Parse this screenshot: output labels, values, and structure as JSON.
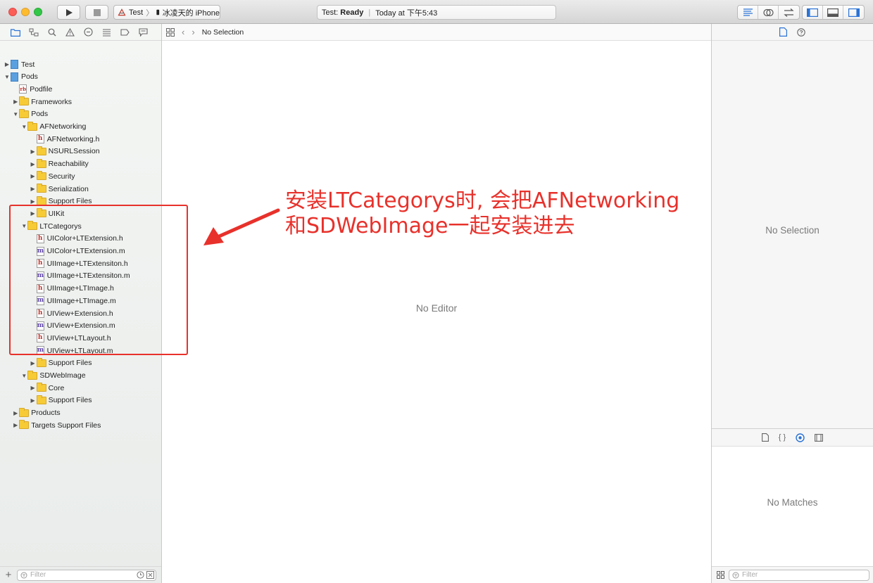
{
  "toolbar": {
    "scheme_name": "Test",
    "device_name": "冰凌天的 iPhone",
    "activity_prefix": "Test:",
    "activity_status": "Ready",
    "activity_time": "Today at 下午5:43"
  },
  "jump_bar": {
    "label": "No Selection"
  },
  "tree": [
    {
      "label": "Test",
      "kind": "project",
      "level": 0,
      "arrow": "▶"
    },
    {
      "label": "Pods",
      "kind": "project",
      "level": 0,
      "arrow": "▼"
    },
    {
      "label": "Podfile",
      "kind": "podfile",
      "level": 1,
      "arrow": ""
    },
    {
      "label": "Frameworks",
      "kind": "folder",
      "level": 1,
      "arrow": "▶"
    },
    {
      "label": "Pods",
      "kind": "folder",
      "level": 1,
      "arrow": "▼"
    },
    {
      "label": "AFNetworking",
      "kind": "folder",
      "level": 2,
      "arrow": "▼"
    },
    {
      "label": "AFNetworking.h",
      "kind": "h",
      "level": 3,
      "arrow": ""
    },
    {
      "label": "NSURLSession",
      "kind": "folder",
      "level": 3,
      "arrow": "▶"
    },
    {
      "label": "Reachability",
      "kind": "folder",
      "level": 3,
      "arrow": "▶"
    },
    {
      "label": "Security",
      "kind": "folder",
      "level": 3,
      "arrow": "▶"
    },
    {
      "label": "Serialization",
      "kind": "folder",
      "level": 3,
      "arrow": "▶"
    },
    {
      "label": "Support Files",
      "kind": "folder",
      "level": 3,
      "arrow": "▶"
    },
    {
      "label": "UIKit",
      "kind": "folder",
      "level": 3,
      "arrow": "▶"
    },
    {
      "label": "LTCategorys",
      "kind": "folder",
      "level": 2,
      "arrow": "▼"
    },
    {
      "label": "UIColor+LTExtension.h",
      "kind": "h",
      "level": 3,
      "arrow": ""
    },
    {
      "label": "UIColor+LTExtension.m",
      "kind": "m",
      "level": 3,
      "arrow": ""
    },
    {
      "label": "UIImage+LTExtensiton.h",
      "kind": "h",
      "level": 3,
      "arrow": ""
    },
    {
      "label": "UIImage+LTExtensiton.m",
      "kind": "m",
      "level": 3,
      "arrow": ""
    },
    {
      "label": "UIImage+LTImage.h",
      "kind": "h",
      "level": 3,
      "arrow": ""
    },
    {
      "label": "UIImage+LTImage.m",
      "kind": "m",
      "level": 3,
      "arrow": ""
    },
    {
      "label": "UIView+Extension.h",
      "kind": "h",
      "level": 3,
      "arrow": ""
    },
    {
      "label": "UIView+Extension.m",
      "kind": "m",
      "level": 3,
      "arrow": ""
    },
    {
      "label": "UIView+LTLayout.h",
      "kind": "h",
      "level": 3,
      "arrow": ""
    },
    {
      "label": "UIView+LTLayout.m",
      "kind": "m",
      "level": 3,
      "arrow": ""
    },
    {
      "label": "Support Files",
      "kind": "folder",
      "level": 3,
      "arrow": "▶"
    },
    {
      "label": "SDWebImage",
      "kind": "folder",
      "level": 2,
      "arrow": "▼"
    },
    {
      "label": "Core",
      "kind": "folder",
      "level": 3,
      "arrow": "▶"
    },
    {
      "label": "Support Files",
      "kind": "folder",
      "level": 3,
      "arrow": "▶"
    },
    {
      "label": "Products",
      "kind": "folder",
      "level": 1,
      "arrow": "▶"
    },
    {
      "label": "Targets Support Files",
      "kind": "folder",
      "level": 1,
      "arrow": "▶"
    }
  ],
  "navigator_filter": {
    "placeholder": "Filter"
  },
  "editor": {
    "empty_label": "No Editor"
  },
  "inspector": {
    "empty_label": "No Selection"
  },
  "library": {
    "empty_label": "No Matches",
    "filter_placeholder": "Filter"
  },
  "annotation": {
    "line1": "安装LTCategorys时, 会把AFNetworking",
    "line2": "和SDWebImage一起安装进去",
    "color": "#e8312b"
  }
}
